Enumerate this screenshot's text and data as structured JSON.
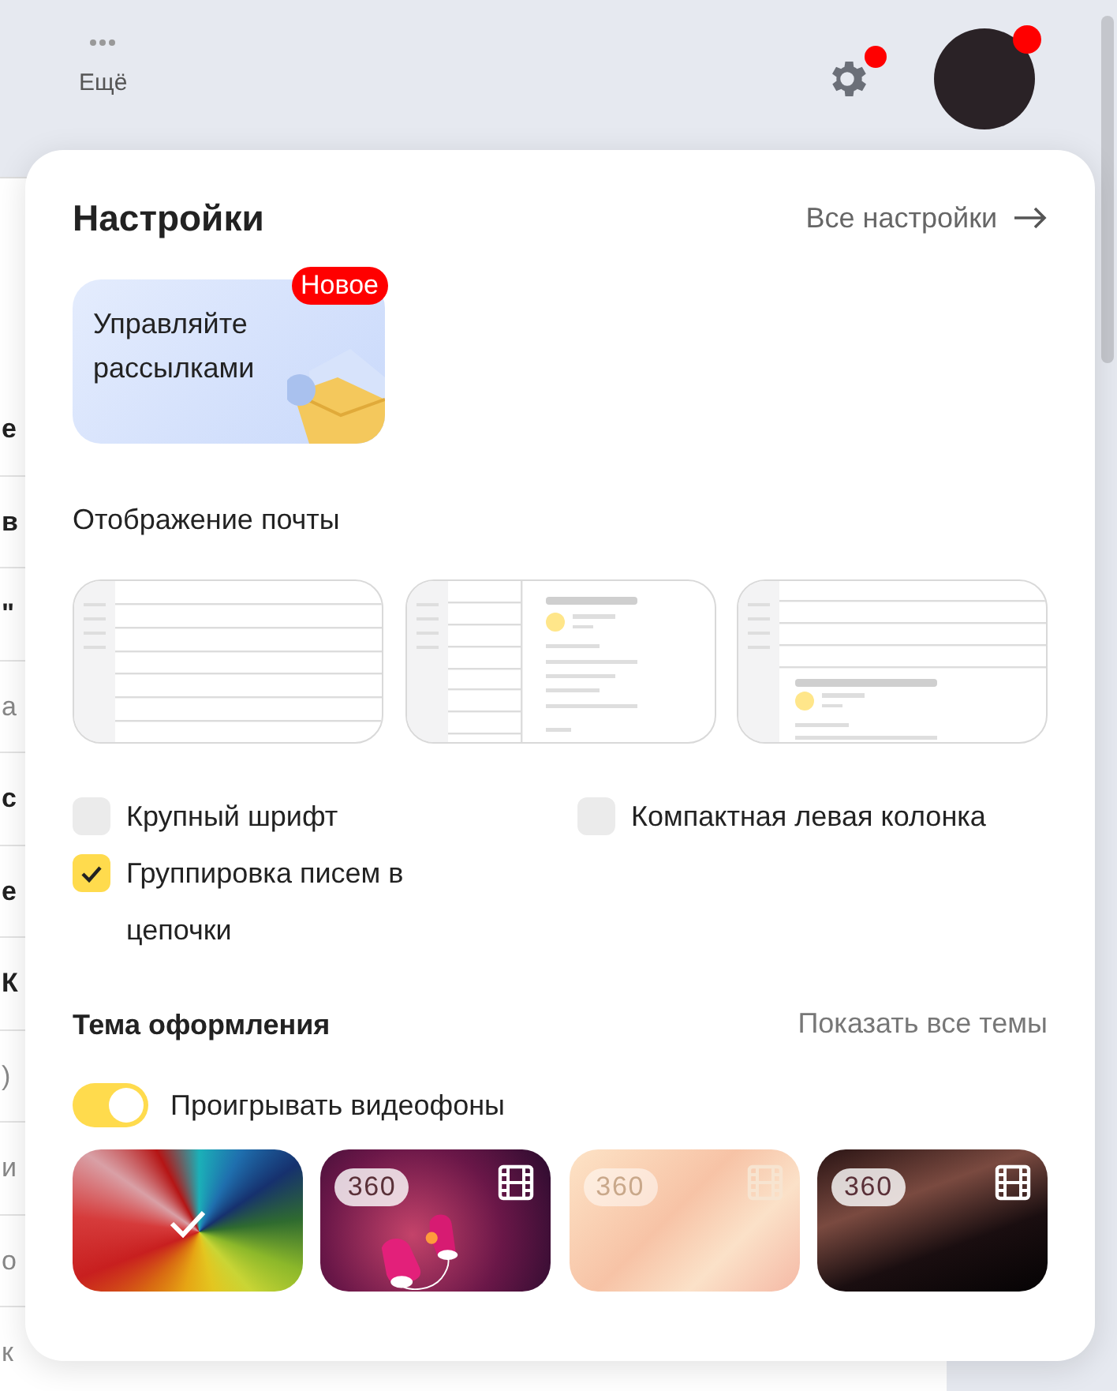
{
  "header": {
    "more_label": "Ещё",
    "settings_notification": true,
    "avatar_notification": true
  },
  "background_items": [
    {
      "text": "е",
      "unread": true
    },
    {
      "text": "в",
      "unread": true
    },
    {
      "text": "\"",
      "unread": true
    },
    {
      "text": "а",
      "unread": false
    },
    {
      "text": "с",
      "unread": true
    },
    {
      "text": "е",
      "unread": true
    },
    {
      "text": "К",
      "unread": true
    },
    {
      "text": ")",
      "unread": false
    },
    {
      "text": "и",
      "unread": false
    },
    {
      "text": "о",
      "unread": false
    },
    {
      "text": "к",
      "unread": false
    }
  ],
  "popup": {
    "title": "Настройки",
    "all_settings_link": "Все настройки",
    "promo": {
      "badge": "Новое",
      "text": "Управляйте рассылками"
    },
    "mail_display": {
      "heading": "Отображение почты",
      "layouts": [
        {
          "kind": "list"
        },
        {
          "kind": "split-vertical"
        },
        {
          "kind": "split-horizontal"
        }
      ]
    },
    "options": [
      {
        "label": "Крупный шрифт",
        "checked": false
      },
      {
        "label": "Компактная левая колонка",
        "checked": false
      },
      {
        "label": "Группировка писем в цепочки",
        "checked": true
      }
    ],
    "theme": {
      "heading": "Тема оформления",
      "show_all_link": "Показать все темы",
      "video_toggle": {
        "label": "Проигрывать видеофоны",
        "on": true
      },
      "themes": [
        {
          "kind": "static",
          "selected": true
        },
        {
          "kind": "video",
          "badge": "360",
          "selected": false
        },
        {
          "kind": "video",
          "badge": "360",
          "selected": false
        },
        {
          "kind": "video",
          "badge": "360",
          "selected": false
        }
      ]
    }
  }
}
